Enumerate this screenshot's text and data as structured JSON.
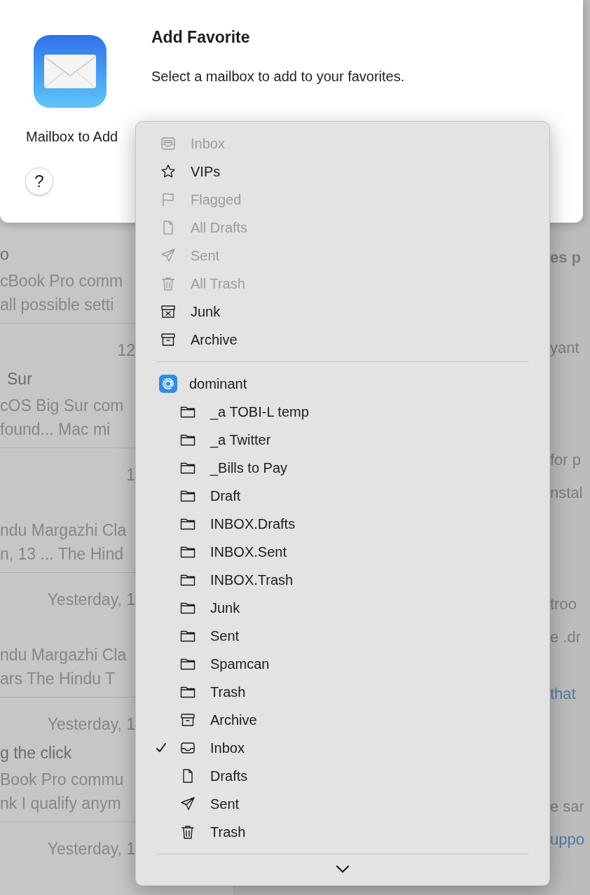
{
  "background": {
    "message_list": [
      {
        "title": "o",
        "preview": [
          "cBook Pro comm",
          "all possible setti"
        ]
      },
      {
        "date": "12",
        "title": "Sur",
        "preview": [
          "cOS Big Sur com",
          "found... Mac mi"
        ]
      },
      {
        "date": "1",
        "preview": [
          "ndu Margazhi Cla",
          "n, 13 ... The Hind"
        ]
      },
      {
        "date": "Yesterday, 1",
        "preview": [
          "ndu Margazhi Cla",
          "ars The Hindu T"
        ]
      },
      {
        "date": "Yesterday, 1",
        "title": "g the click",
        "preview": [
          "Book Pro commu",
          "nk I qualify anym"
        ]
      },
      {
        "date": "Yesterday, 1"
      }
    ],
    "reading_pane": [
      {
        "lines": [
          {
            "text": "es p",
            "kind": "heading"
          }
        ]
      },
      {
        "lines": [
          {
            "text": "yant",
            "kind": "text"
          }
        ]
      },
      {
        "lines": [
          {
            "text": "for p",
            "kind": "text"
          },
          {
            "text": "nstal",
            "kind": "text"
          }
        ]
      },
      {
        "lines": [
          {
            "text": "troo",
            "kind": "text"
          },
          {
            "text": "e .dr",
            "kind": "text"
          }
        ]
      },
      {
        "lines": [
          {
            "text": "that",
            "kind": "link"
          }
        ]
      },
      {
        "lines": [
          {
            "text": "e sar",
            "kind": "text"
          },
          {
            "text": "uppo",
            "kind": "link"
          }
        ]
      }
    ]
  },
  "dialog": {
    "title": "Add Favorite",
    "message": "Select a mailbox to add to your favorites.",
    "field_label": "Mailbox to Add",
    "help": "?"
  },
  "menu": {
    "smart_mailboxes": [
      {
        "label": "Inbox",
        "kind": "inbox",
        "disabled": true
      },
      {
        "label": "VIPs",
        "kind": "star",
        "disabled": false
      },
      {
        "label": "Flagged",
        "kind": "flag",
        "disabled": true
      },
      {
        "label": "All Drafts",
        "kind": "document",
        "disabled": true
      },
      {
        "label": "Sent",
        "kind": "sent",
        "disabled": true
      },
      {
        "label": "All Trash",
        "kind": "trash",
        "disabled": true
      },
      {
        "label": "Junk",
        "kind": "junk",
        "disabled": false
      },
      {
        "label": "Archive",
        "kind": "archive",
        "disabled": false
      }
    ],
    "account": {
      "name": "dominant",
      "mailboxes": [
        {
          "label": "_a TOBI-L temp",
          "kind": "folder",
          "checked": false
        },
        {
          "label": "_a Twitter",
          "kind": "folder",
          "checked": false
        },
        {
          "label": "_Bills to Pay",
          "kind": "folder",
          "checked": false
        },
        {
          "label": "Draft",
          "kind": "folder",
          "checked": false
        },
        {
          "label": "INBOX.Drafts",
          "kind": "folder",
          "checked": false
        },
        {
          "label": "INBOX.Sent",
          "kind": "folder",
          "checked": false
        },
        {
          "label": "INBOX.Trash",
          "kind": "folder",
          "checked": false
        },
        {
          "label": "Junk",
          "kind": "folder",
          "checked": false
        },
        {
          "label": "Sent",
          "kind": "folder",
          "checked": false
        },
        {
          "label": "Spamcan",
          "kind": "folder",
          "checked": false
        },
        {
          "label": "Trash",
          "kind": "folder",
          "checked": false
        },
        {
          "label": "Archive",
          "kind": "archive",
          "checked": false
        },
        {
          "label": "Inbox",
          "kind": "inbox",
          "checked": true
        },
        {
          "label": "Drafts",
          "kind": "document",
          "checked": false
        },
        {
          "label": "Sent",
          "kind": "sent",
          "checked": false
        },
        {
          "label": "Trash",
          "kind": "trash",
          "checked": false
        }
      ]
    }
  }
}
